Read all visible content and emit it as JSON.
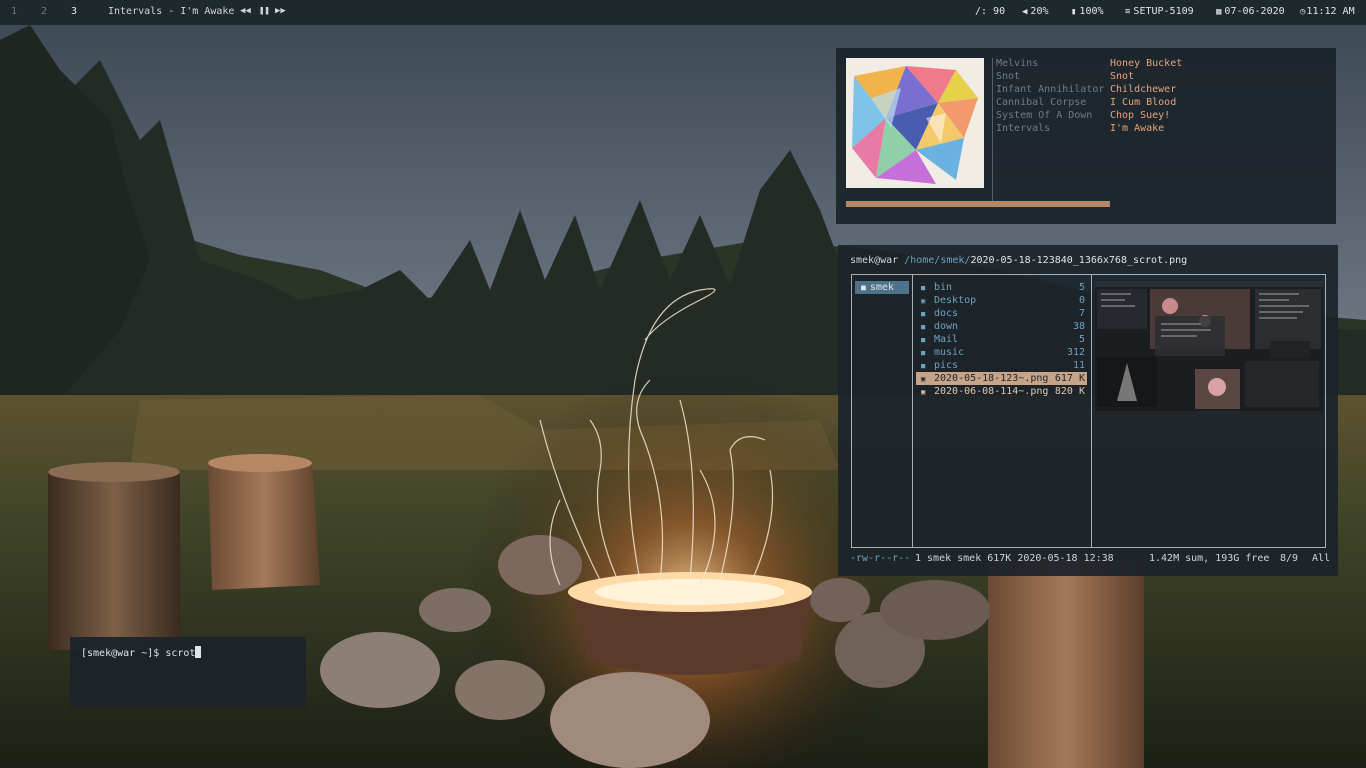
{
  "topbar": {
    "workspaces": [
      "1",
      "2",
      "3"
    ],
    "active_workspace": "3",
    "now_playing": "Intervals - I'm Awake",
    "controls": {
      "prev_icon": "prev-icon",
      "pause_icon": "pause-icon",
      "next_icon": "next-icon"
    },
    "disk": "/: 90",
    "volume": "20%",
    "battery": "100%",
    "wifi": "SETUP-5109",
    "date": "07-06-2020",
    "time": "11:12 AM"
  },
  "music_panel": {
    "cover_art": "album-cover",
    "playlist": [
      {
        "artist": "Melvins",
        "song": "Honey Bucket"
      },
      {
        "artist": "Snot",
        "song": "Snot"
      },
      {
        "artist": "Infant Annihilator",
        "song": "Childchewer"
      },
      {
        "artist": "Cannibal Corpse",
        "song": "I Cum Blood"
      },
      {
        "artist": "System Of A Down",
        "song": "Chop Suey!"
      },
      {
        "artist": "Intervals",
        "song": "I'm Awake"
      }
    ],
    "progress": 0.55,
    "colors": {
      "song": "#e3a57c",
      "artist": "#6f7c85",
      "progress": "#b48668"
    }
  },
  "ranger": {
    "path": {
      "host": "smek@war",
      "dir": "/home/smek/",
      "file": "2020-05-18-123840_1366x768_scrot.png"
    },
    "parent": "smek",
    "entries": [
      {
        "name": "bin",
        "size": "5",
        "type": "dir"
      },
      {
        "name": "Desktop",
        "size": "0",
        "type": "dir"
      },
      {
        "name": "docs",
        "size": "7",
        "type": "dir"
      },
      {
        "name": "down",
        "size": "38",
        "type": "dir"
      },
      {
        "name": "Mail",
        "size": "5",
        "type": "dir"
      },
      {
        "name": "music",
        "size": "312",
        "type": "dir"
      },
      {
        "name": "pics",
        "size": "11",
        "type": "dir"
      },
      {
        "name": "2020-05-18-123~.png",
        "size": "617 K",
        "type": "file",
        "selected": true
      },
      {
        "name": "2020-06-08-114~.png",
        "size": "820 K",
        "type": "file"
      }
    ],
    "status": {
      "permissions": "-rw-r--r--",
      "info": "1 smek smek 617K 2020-05-18 12:38",
      "summary": "1.42M sum, 193G free",
      "position": "8/9",
      "scroll": "All"
    },
    "colors": {
      "dir": "#6ea2c0",
      "selected_bg": "#c7a387"
    }
  },
  "terminal": {
    "prompt": "[smek@war ~]$",
    "command": "scrot"
  }
}
